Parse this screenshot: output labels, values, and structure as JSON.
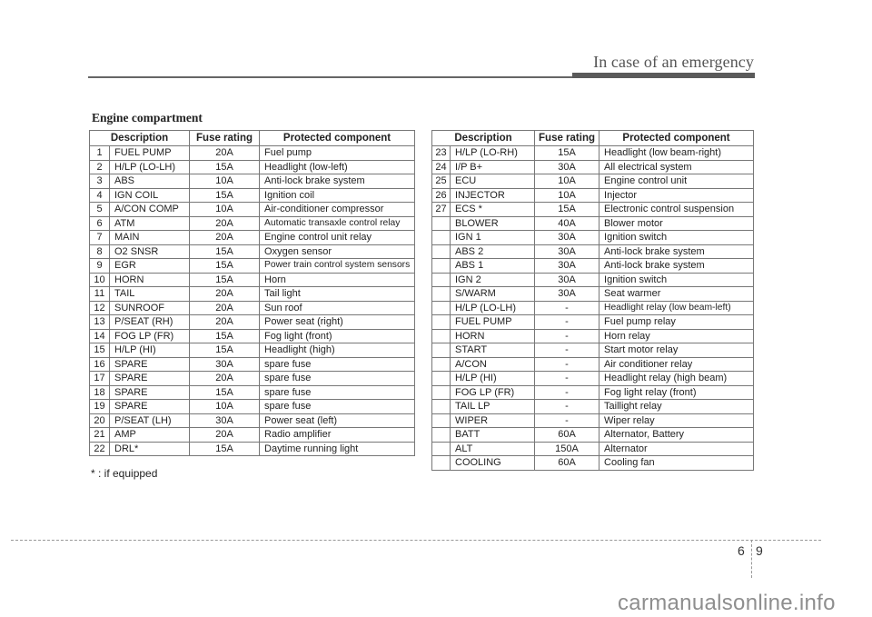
{
  "header": {
    "title": "In case of an emergency"
  },
  "section_title": "Engine compartment",
  "columns": {
    "description": "Description",
    "fuse_rating": "Fuse rating",
    "protected_component": "Protected component"
  },
  "left_table": [
    {
      "num": "1",
      "description": "FUEL PUMP",
      "rating": "20A",
      "component": "Fuel pump"
    },
    {
      "num": "2",
      "description": "H/LP (LO-LH)",
      "rating": "15A",
      "component": "Headlight (low-left)"
    },
    {
      "num": "3",
      "description": "ABS",
      "rating": "10A",
      "component": "Anti-lock brake system"
    },
    {
      "num": "4",
      "description": "IGN COIL",
      "rating": "15A",
      "component": "Ignition coil"
    },
    {
      "num": "5",
      "description": "A/CON COMP",
      "rating": "10A",
      "component": "Air-conditioner compressor"
    },
    {
      "num": "6",
      "description": "ATM",
      "rating": "20A",
      "component": "Automatic transaxle control relay"
    },
    {
      "num": "7",
      "description": "MAIN",
      "rating": "20A",
      "component": "Engine control unit relay"
    },
    {
      "num": "8",
      "description": "O2 SNSR",
      "rating": "15A",
      "component": "Oxygen sensor"
    },
    {
      "num": "9",
      "description": "EGR",
      "rating": "15A",
      "component": "Power train control system sensors"
    },
    {
      "num": "10",
      "description": "HORN",
      "rating": "15A",
      "component": "Horn"
    },
    {
      "num": "11",
      "description": "TAIL",
      "rating": "20A",
      "component": "Tail light"
    },
    {
      "num": "12",
      "description": "SUNROOF",
      "rating": "20A",
      "component": "Sun roof"
    },
    {
      "num": "13",
      "description": "P/SEAT (RH)",
      "rating": "20A",
      "component": "Power seat (right)"
    },
    {
      "num": "14",
      "description": "FOG LP (FR)",
      "rating": "15A",
      "component": "Fog light (front)"
    },
    {
      "num": "15",
      "description": "H/LP (HI)",
      "rating": "15A",
      "component": "Headlight (high)"
    },
    {
      "num": "16",
      "description": "SPARE",
      "rating": "30A",
      "component": "spare fuse"
    },
    {
      "num": "17",
      "description": "SPARE",
      "rating": "20A",
      "component": "spare fuse"
    },
    {
      "num": "18",
      "description": "SPARE",
      "rating": "15A",
      "component": "spare fuse"
    },
    {
      "num": "19",
      "description": "SPARE",
      "rating": "10A",
      "component": "spare fuse"
    },
    {
      "num": "20",
      "description": "P/SEAT (LH)",
      "rating": "30A",
      "component": "Power seat (left)"
    },
    {
      "num": "21",
      "description": "AMP",
      "rating": "20A",
      "component": "Radio amplifier"
    },
    {
      "num": "22",
      "description": "DRL*",
      "rating": "15A",
      "component": "Daytime running light"
    }
  ],
  "right_table": [
    {
      "num": "23",
      "description": "H/LP (LO-RH)",
      "rating": "15A",
      "component": "Headlight (low beam-right)"
    },
    {
      "num": "24",
      "description": "I/P B+",
      "rating": "30A",
      "component": "All electrical system"
    },
    {
      "num": "25",
      "description": "ECU",
      "rating": "10A",
      "component": "Engine control unit"
    },
    {
      "num": "26",
      "description": "INJECTOR",
      "rating": "10A",
      "component": "Injector"
    },
    {
      "num": "27",
      "description": "ECS *",
      "rating": "15A",
      "component": "Electronic control suspension"
    },
    {
      "num": "",
      "description": "BLOWER",
      "rating": "40A",
      "component": "Blower motor"
    },
    {
      "num": "",
      "description": "IGN 1",
      "rating": "30A",
      "component": "Ignition switch"
    },
    {
      "num": "",
      "description": "ABS 2",
      "rating": "30A",
      "component": "Anti-lock brake system"
    },
    {
      "num": "",
      "description": "ABS 1",
      "rating": "30A",
      "component": "Anti-lock brake system"
    },
    {
      "num": "",
      "description": "IGN 2",
      "rating": "30A",
      "component": "Ignition switch"
    },
    {
      "num": "",
      "description": "S/WARM",
      "rating": "30A",
      "component": "Seat warmer"
    },
    {
      "num": "",
      "description": "H/LP (LO-LH)",
      "rating": "-",
      "component": "Headlight relay (low beam-left)"
    },
    {
      "num": "",
      "description": "FUEL PUMP",
      "rating": "-",
      "component": "Fuel pump relay"
    },
    {
      "num": "",
      "description": "HORN",
      "rating": "-",
      "component": "Horn relay"
    },
    {
      "num": "",
      "description": "START",
      "rating": "-",
      "component": "Start motor relay"
    },
    {
      "num": "",
      "description": "A/CON",
      "rating": "-",
      "component": "Air conditioner relay"
    },
    {
      "num": "",
      "description": "H/LP (HI)",
      "rating": "-",
      "component": "Headlight relay (high beam)"
    },
    {
      "num": "",
      "description": "FOG LP (FR)",
      "rating": "-",
      "component": "Fog light relay (front)"
    },
    {
      "num": "",
      "description": "TAIL LP",
      "rating": "-",
      "component": "Taillight relay"
    },
    {
      "num": "",
      "description": "WIPER",
      "rating": "-",
      "component": "Wiper relay"
    },
    {
      "num": "",
      "description": "BATT",
      "rating": "60A",
      "component": "Alternator, Battery"
    },
    {
      "num": "",
      "description": "ALT",
      "rating": "150A",
      "component": "Alternator"
    },
    {
      "num": "",
      "description": "COOLING",
      "rating": "60A",
      "component": "Cooling fan"
    }
  ],
  "footnote": "* : if equipped",
  "footer": {
    "chapter": "6",
    "page": "9"
  },
  "watermark": "carmanualsonline.info"
}
